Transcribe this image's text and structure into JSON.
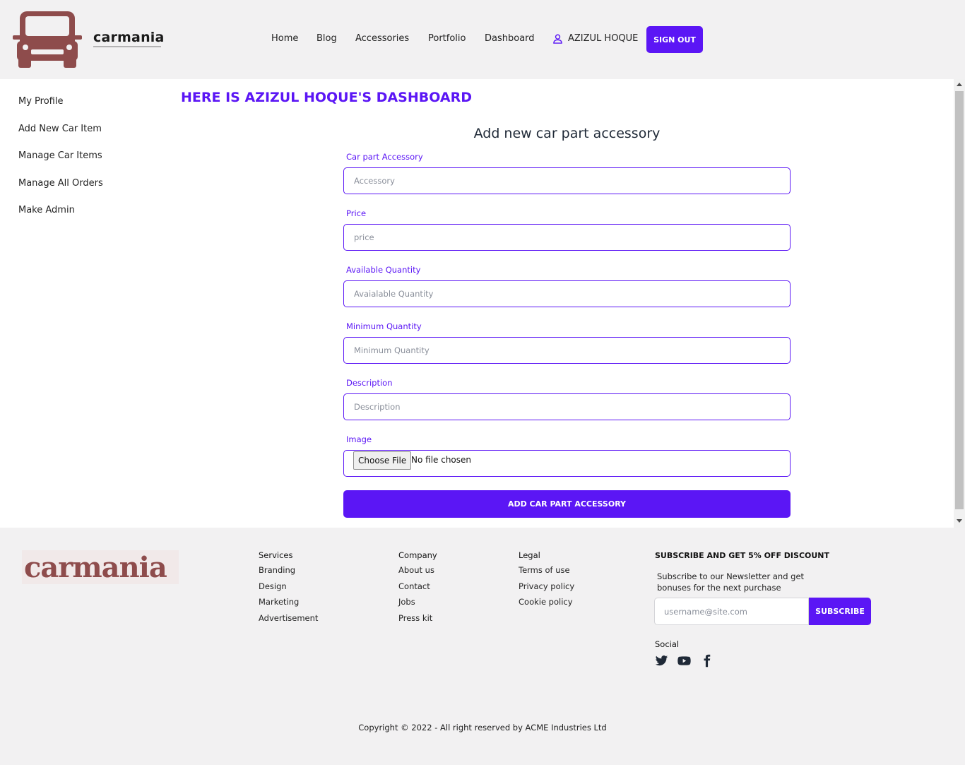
{
  "header": {
    "logo_text": "carmania",
    "nav": [
      {
        "label": "Home"
      },
      {
        "label": "Blog"
      },
      {
        "label": "Accessories"
      },
      {
        "label": "Portfolio"
      },
      {
        "label": "Dashboard"
      }
    ],
    "user_name": "AZIZUL HOQUE",
    "signout_label": "SIGN OUT"
  },
  "sidebar": {
    "items": [
      {
        "label": "My Profile"
      },
      {
        "label": "Add New Car Item"
      },
      {
        "label": "Manage Car Items"
      },
      {
        "label": "Manage All Orders"
      },
      {
        "label": "Make Admin"
      }
    ]
  },
  "dashboard_title": "HERE IS AZIZUL HOQUE'S DASHBOARD",
  "form": {
    "title": "Add new car part accessory",
    "fields": [
      {
        "label": "Car part Accessory",
        "placeholder": "Accessory",
        "value": ""
      },
      {
        "label": "Price",
        "placeholder": "price",
        "value": ""
      },
      {
        "label": "Available Quantity",
        "placeholder": "Avaialable Quantity",
        "value": ""
      },
      {
        "label": "Minimum Quantity",
        "placeholder": "Minimum Quantity",
        "value": ""
      },
      {
        "label": "Description",
        "placeholder": "Description",
        "value": ""
      }
    ],
    "image": {
      "label": "Image",
      "button_label": "Choose File",
      "status": "No file chosen"
    },
    "submit_label": "ADD CAR PART ACCESSORY"
  },
  "footer": {
    "logo_text": "carmania",
    "columns": [
      {
        "title": "Services",
        "links": [
          "Branding",
          "Design",
          "Marketing",
          "Advertisement"
        ]
      },
      {
        "title": "Company",
        "links": [
          "About us",
          "Contact",
          "Jobs",
          "Press kit"
        ]
      },
      {
        "title": "Legal",
        "links": [
          "Terms of use",
          "Privacy policy",
          "Cookie policy"
        ]
      }
    ],
    "subscribe": {
      "title": "SUBSCRIBE AND GET 5% OFF DISCOUNT",
      "text": "Subscribe to our Newsletter and get bonuses for the next purchase",
      "placeholder": "username@site.com",
      "button_label": "SUBSCRIBE"
    },
    "social_title": "Social",
    "social_icons": [
      "twitter-icon",
      "youtube-icon",
      "facebook-icon"
    ],
    "copyright": "Copyright © 2022 - All right reserved by ACME Industries Ltd"
  },
  "colors": {
    "accent": "#5b16f5",
    "logo_brown": "#8e4c4c",
    "background": "#f2f1f2",
    "panel": "#ffffff"
  }
}
